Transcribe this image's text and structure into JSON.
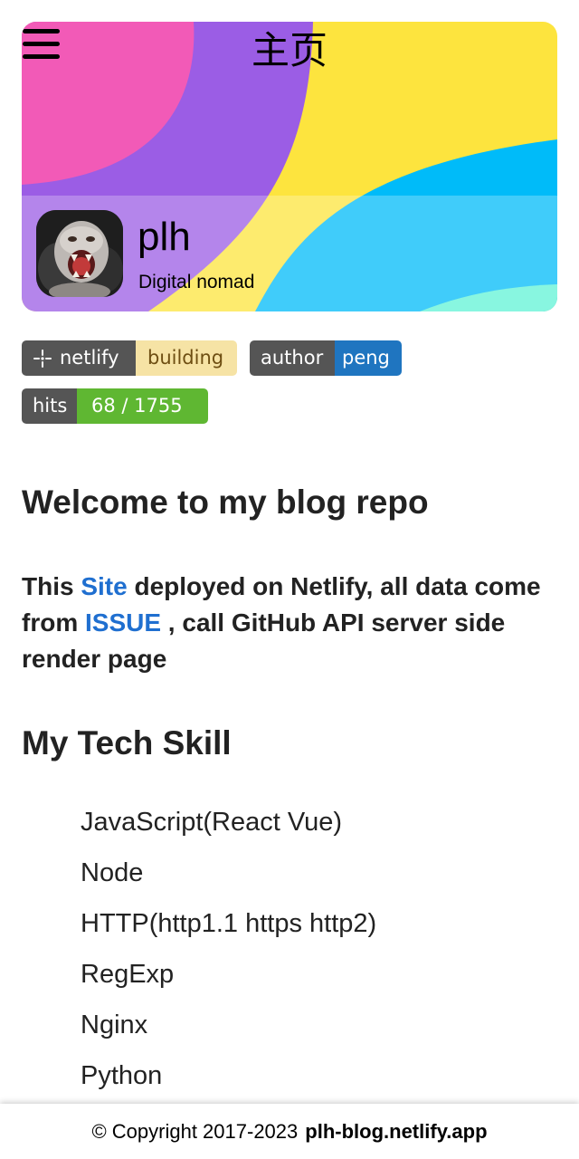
{
  "header": {
    "title": "主页",
    "profile": {
      "name": "plh",
      "bio": "Digital nomad"
    },
    "colors": {
      "yellow": "#fde43e",
      "pink": "#f25ab7",
      "purple": "#9b5de5",
      "blue": "#00bbf9",
      "teal": "#61f3d6"
    }
  },
  "badges": {
    "netlify": {
      "label": "netlify",
      "value": "building"
    },
    "author": {
      "label": "author",
      "value": "peng"
    },
    "hits": {
      "label": "hits",
      "value": "68 / 1755"
    }
  },
  "content": {
    "welcome_heading": "Welcome to my blog repo",
    "intro": {
      "part1": "This ",
      "site_link": "Site",
      "part2": "  deployed on Netlify,   all data come from ",
      "issue_link": "ISSUE",
      "part3": " , call GitHub API server side render page"
    },
    "skills_heading": "My Tech Skill",
    "skills": [
      "JavaScript(React Vue)",
      "Node",
      "HTTP(http1.1 https http2)",
      "RegExp",
      "Nginx",
      "Python"
    ]
  },
  "footer": {
    "copyright": "© Copyright 2017-2023",
    "site": "plh-blog.netlify.app"
  }
}
